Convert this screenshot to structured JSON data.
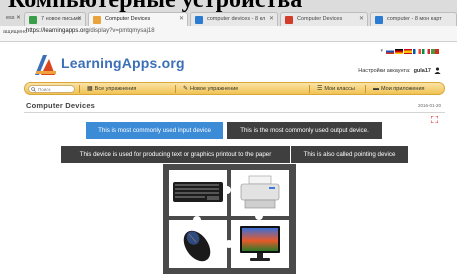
{
  "overlay_title": "Компьютерные устройства",
  "browser": {
    "tabs": [
      {
        "label": "ess",
        "active": false,
        "fav": "#8c8c8c"
      },
      {
        "label": "7 новое письмо",
        "active": false,
        "fav": "#3a9d48"
      },
      {
        "label": "Computer Devices",
        "active": true,
        "fav": "#e8a33c"
      },
      {
        "label": "computer devices - 8 кл",
        "active": false,
        "fav": "#2b7bd3"
      },
      {
        "label": "Computer Devices",
        "active": false,
        "fav": "#d33b2b"
      },
      {
        "label": "computer - 8 мон карт",
        "active": false,
        "fav": "#2b7bd3"
      }
    ],
    "secure_label": "ащищено",
    "url_host": "https://learningapps.org",
    "url_path": "/display?v=pmtqmysaj18"
  },
  "site": {
    "logo_text": "LearningApps.org",
    "user_label": "Настройки аккаунта:",
    "username": "gula17",
    "languages": [
      "ru",
      "de",
      "es",
      "fr",
      "it",
      "en"
    ],
    "colors": {
      "logo_blue": "#3b6fb6",
      "nav_gold": "#f0c253",
      "tile_blue": "#3c8bd6",
      "tile_dark": "#3f3f3f"
    }
  },
  "nav": {
    "search_placeholder": "Поиск",
    "all_exercises": "Все упражнения",
    "new_exercise": "Новое упражнение",
    "my_classes": "Мои классы",
    "my_apps": "Мои приложения"
  },
  "page": {
    "title": "Computer Devices",
    "date": "2016-01-20"
  },
  "exercise": {
    "labels": [
      "This is most commonly used input device",
      "This is the most commonly used output device.",
      "This device is used for producing text or graphics printout to the paper",
      "This is also called pointing device"
    ],
    "pieces": [
      "keyboard-image",
      "printer-image",
      "mouse-image",
      "monitor-image"
    ]
  }
}
